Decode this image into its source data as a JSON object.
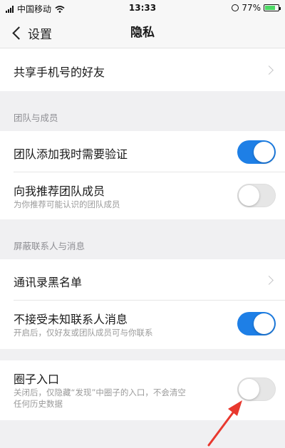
{
  "status_bar": {
    "carrier": "中国移动",
    "time": "13:33",
    "battery": "77%",
    "battery_level": 0.77
  },
  "nav": {
    "back_label": "设置",
    "title": "隐私"
  },
  "rows": {
    "share_phone": {
      "title": "共享手机号的好友"
    },
    "team_header": "团队与成员",
    "team_verify": {
      "title": "团队添加我时需要验证",
      "on": true
    },
    "recommend": {
      "title": "向我推荐团队成员",
      "subtitle": "为你推荐可能认识的团队成员",
      "on": false
    },
    "block_header": "屏蔽联系人与消息",
    "blacklist": {
      "title": "通讯录黑名单"
    },
    "unknown_msg": {
      "title": "不接受未知联系人消息",
      "subtitle": "开启后，仅好友或团队成员可与你联系",
      "on": true
    },
    "moments": {
      "title": "圈子入口",
      "subtitle_line1": "关闭后，仅隐藏“发现”中圈子的入口，不会清空",
      "subtitle_line2": "任何历史数据",
      "on": false
    }
  },
  "colors": {
    "toggle_on": "#1e7fe6",
    "arrow": "#e8382e"
  },
  "icons": [
    "signal-icon",
    "wifi-icon",
    "lock-rotation-icon",
    "battery-icon",
    "back-chevron-icon",
    "chevron-right-icon",
    "red-arrow-annotation"
  ]
}
